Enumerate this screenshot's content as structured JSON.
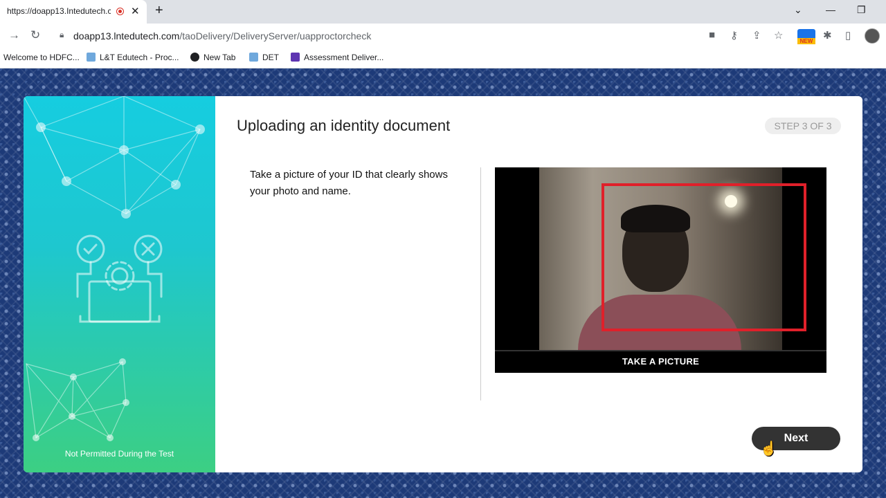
{
  "browser": {
    "tab_title": "https://doapp13.Intedutech.c",
    "tab_close": "✕",
    "new_tab": "+",
    "url_host": "doapp13.lntedutech.com",
    "url_path": "/taoDelivery/DeliveryServer/uapproctorcheck",
    "new_badge": "NEW",
    "bookmarks": [
      {
        "label": "Welcome to HDFC...",
        "color": "#ffffff"
      },
      {
        "label": "L&T Edutech - Proc...",
        "color": "#6fa8dc"
      },
      {
        "label": "New Tab",
        "color": "#202124"
      },
      {
        "label": "DET",
        "color": "#6fa8dc"
      },
      {
        "label": "Assessment Deliver...",
        "color": "#5e35b1"
      }
    ]
  },
  "page": {
    "title": "Uploading an identity document",
    "step": "STEP 3 OF 3",
    "instruction": "Take a picture of your ID that clearly shows your photo and name.",
    "camera_button": "TAKE A PICTURE",
    "next_button": "Next",
    "sidebar_note": "Not Permitted During the Test",
    "accent_color": "#e0202a"
  }
}
